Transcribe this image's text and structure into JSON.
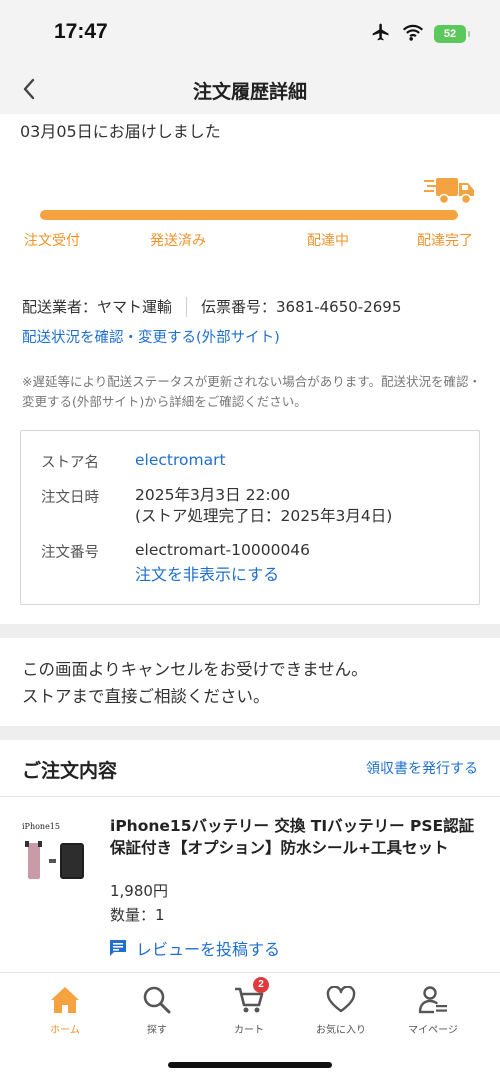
{
  "status_bar": {
    "time": "17:47",
    "battery": "52"
  },
  "nav": {
    "title": "注文履歴詳細"
  },
  "delivery": {
    "status_text": "03月05日にお届けしました",
    "steps": [
      "注文受付",
      "発送済み",
      "配達中",
      "配達完了"
    ],
    "progress": 1.0,
    "carrier_label": "配送業者：ヤマト運輸",
    "tracking_label": "伝票番号：3681-4650-2695",
    "tracking_link": "配送状況を確認・変更する(外部サイト)",
    "notice": "※遅延等により配送ステータスが更新されない場合があります。配送状況を確認・変更する(外部サイト)から詳細をご確認ください。"
  },
  "order_info": {
    "store_label": "ストア名",
    "store_value": "electromart",
    "date_label": "注文日時",
    "date_value": "2025年3月3日 22:00",
    "date_sub": "(ストア処理完了日：2025年3月4日)",
    "number_label": "注文番号",
    "number_value": "electromart-10000046",
    "hide_link": "注文を非表示にする"
  },
  "cancel_notice": {
    "line1": "この画面よりキャンセルをお受けできません。",
    "line2": "ストアまで直接ご相談ください。"
  },
  "order_contents": {
    "title": "ご注文内容",
    "receipt_link": "領収書を発行する",
    "item": {
      "thumb_label": "iPhone15",
      "name": "iPhone15バッテリー 交換 TIバッテリー PSE認証 保証付き【オプション】防水シール+工具セット",
      "price": "1,980円",
      "quantity": "数量：1",
      "review_link": "レビューを投稿する"
    }
  },
  "tab_bar": {
    "tabs": [
      {
        "label": "ホーム",
        "icon": "home-icon"
      },
      {
        "label": "探す",
        "icon": "search-icon"
      },
      {
        "label": "カート",
        "icon": "cart-icon",
        "badge": "2"
      },
      {
        "label": "お気に入り",
        "icon": "heart-icon"
      },
      {
        "label": "マイページ",
        "icon": "user-icon"
      }
    ]
  },
  "colors": {
    "accent": "#f5a340",
    "link": "#1f6fd1",
    "badge": "#e03b3b"
  }
}
